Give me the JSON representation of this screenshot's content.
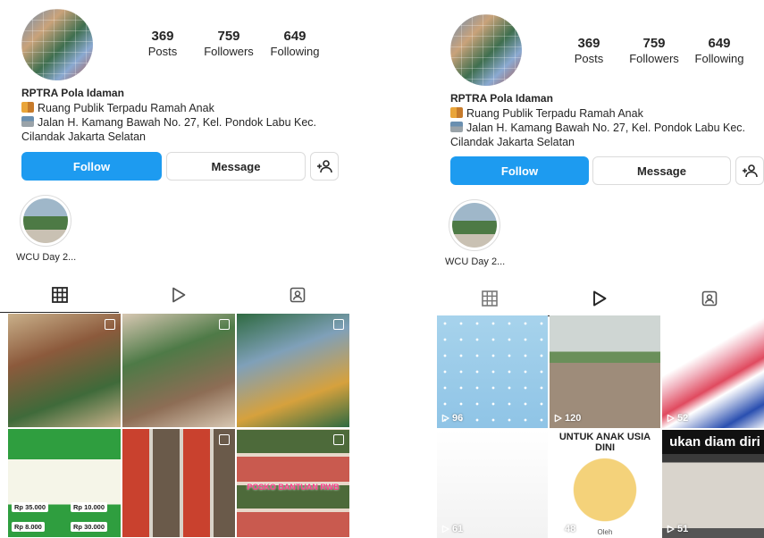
{
  "left": {
    "profile": {
      "name": "RPTRA Pola Idaman",
      "bio_line1": "Ruang Publik Terpadu Ramah Anak",
      "bio_line2": "Jalan H. Kamang Bawah No. 27, Kel. Pondok Labu Kec.",
      "bio_line3": "Cilandak Jakarta Selatan"
    },
    "stats": {
      "posts": {
        "value": "369",
        "label": "Posts"
      },
      "followers": {
        "value": "759",
        "label": "Followers"
      },
      "following": {
        "value": "649",
        "label": "Following"
      }
    },
    "buttons": {
      "follow": "Follow",
      "message": "Message"
    },
    "highlight": {
      "label": "WCU Day 2..."
    },
    "active_tab": "posts",
    "grid": [
      {
        "kind": "photo",
        "colors": [
          "#8c5a3c",
          "#c9b08a",
          "#3f6a3a"
        ]
      },
      {
        "kind": "photo",
        "colors": [
          "#4e7a47",
          "#d7c7b2",
          "#8d6d55"
        ]
      },
      {
        "kind": "photo",
        "colors": [
          "#7fa0b9",
          "#2f6a41",
          "#d6a13d"
        ]
      },
      {
        "kind": "poster-green",
        "colors": [
          "#2f9e3f",
          "#f5f5e8",
          "#f2c94c"
        ],
        "prices": [
          "Rp 35.000",
          "Rp 10.000",
          "Rp 8.000",
          "Rp 30.000"
        ]
      },
      {
        "kind": "collage",
        "colors": [
          "#c9412e",
          "#d8d2c8",
          "#6a5a4a"
        ]
      },
      {
        "kind": "collage-pink",
        "colors": [
          "#c95a4f",
          "#e8d7c9",
          "#4d6a3a"
        ],
        "title": "POSKO BANTUAN RWB"
      }
    ]
  },
  "right": {
    "profile": {
      "name": "RPTRA Pola Idaman",
      "bio_line1": "Ruang Publik Terpadu Ramah Anak",
      "bio_line2": "Jalan H. Kamang Bawah No. 27, Kel. Pondok Labu Kec.",
      "bio_line3": "Cilandak Jakarta Selatan"
    },
    "stats": {
      "posts": {
        "value": "369",
        "label": "Posts"
      },
      "followers": {
        "value": "759",
        "label": "Followers"
      },
      "following": {
        "value": "649",
        "label": "Following"
      }
    },
    "buttons": {
      "follow": "Follow",
      "message": "Message"
    },
    "highlight": {
      "label": "WCU Day 2..."
    },
    "active_tab": "reels",
    "grid": [
      {
        "kind": "reel-dots",
        "views": "96"
      },
      {
        "kind": "reel-playground",
        "views": "120"
      },
      {
        "kind": "reel-blur",
        "views": "52"
      },
      {
        "kind": "reel-blank",
        "views": "61"
      },
      {
        "kind": "reel-cartoon",
        "views": "48",
        "top_text": "UNTUK ANAK USIA DINI",
        "bottom_text": "Oleh"
      },
      {
        "kind": "reel-cassette",
        "views": "51",
        "top_text": "ukan diam diri"
      }
    ]
  },
  "icons": {
    "tab_grid": "grid-icon",
    "tab_reels": "reels-play-icon",
    "tab_tagged": "tagged-person-icon",
    "add_user": "add-user-icon",
    "views": "play-icon"
  },
  "colors": {
    "follow_blue": "#1d9bf0",
    "text": "#262626",
    "border": "#dbdbdb"
  }
}
